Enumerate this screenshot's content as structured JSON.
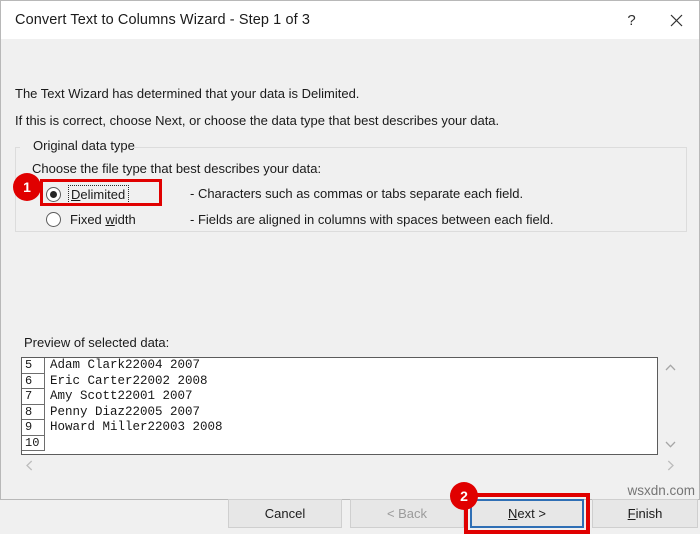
{
  "window": {
    "title": "Convert Text to Columns Wizard - Step 1 of 3",
    "help_icon": "question-mark-icon",
    "close_icon": "close-icon"
  },
  "intro": {
    "line1": "The Text Wizard has determined that your data is Delimited.",
    "line2": "If this is correct, choose Next, or choose the data type that best describes your data."
  },
  "original_data_type": {
    "group_label": "Original data type",
    "instruction": "Choose the file type that best describes your data:",
    "options": [
      {
        "label": "Delimited",
        "accel": "D",
        "description": "- Characters such as commas or tabs separate each field.",
        "selected": true,
        "highlighted": true
      },
      {
        "label": "Fixed width",
        "accel": "w",
        "description": "- Fields are aligned in columns with spaces between each field.",
        "selected": false,
        "highlighted": false
      }
    ]
  },
  "preview": {
    "label": "Preview of selected data:",
    "rows": [
      {
        "number": "5",
        "text": "Adam Clark22004 2007"
      },
      {
        "number": "6",
        "text": "Eric Carter22002 2008"
      },
      {
        "number": "7",
        "text": "Amy Scott22001 2007"
      },
      {
        "number": "8",
        "text": "Penny Diaz22005 2007"
      },
      {
        "number": "9",
        "text": "Howard Miller22003 2008"
      },
      {
        "number": "10",
        "text": ""
      }
    ],
    "scroll_up_icon": "chevron-up-icon",
    "scroll_down_icon": "chevron-down-icon",
    "scroll_left_icon": "chevron-left-icon",
    "scroll_right_icon": "chevron-right-icon"
  },
  "footer": {
    "cancel": "Cancel",
    "back": "< Back",
    "next_prefix": "N",
    "next_accel": "N",
    "next_label": "Next >",
    "finish_label": "Finish",
    "finish_accel": "F",
    "back_disabled": true,
    "next_focused": true,
    "next_highlighted": true
  },
  "annotations": {
    "badge1": "1",
    "badge2": "2"
  },
  "watermark": "wsxdn.com",
  "colors": {
    "highlight_red": "#e00000",
    "focus_blue": "#2f6fb5",
    "dialog_bg": "#f0f0f0",
    "titlebar_bg": "#ffffff"
  }
}
